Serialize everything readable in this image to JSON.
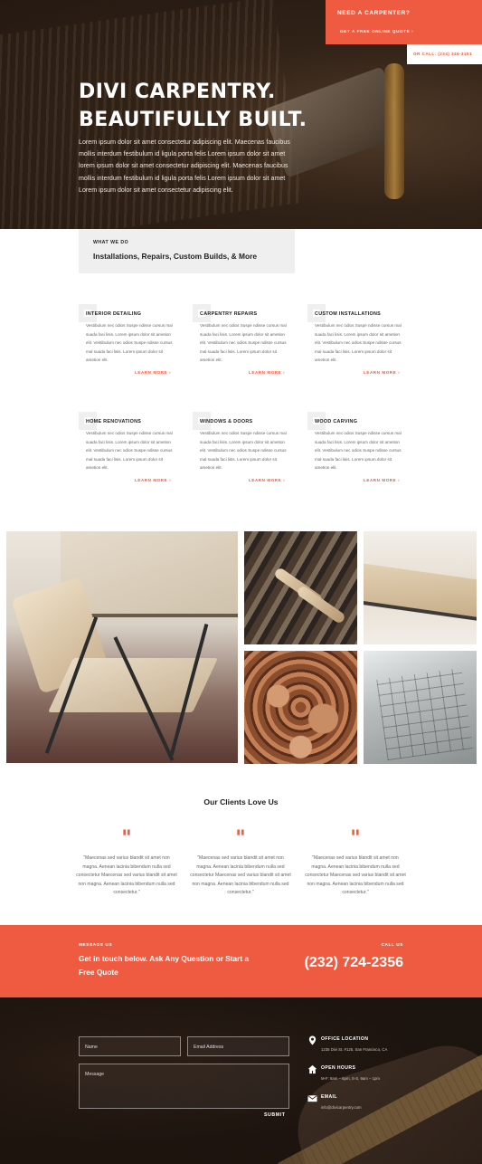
{
  "header": {
    "cta_title": "NEED A CARPENTER?",
    "cta_link": "GET A FREE ONLINE QUOTE ›",
    "phone_line": "OR CALL: (234) 346-3151"
  },
  "hero": {
    "title_line1": "DIVI CARPENTRY.",
    "title_line2": "BEAUTIFULLY BUILT.",
    "text": "Lorem ipsum dolor sit amet consectetur adipiscing elit. Maecenas faucibus mollis interdum festibulum id ligula porta felis Lorem ipsum dolor sit amet lorem ipsum dolor sit amet consectetur adipiscing elit. Maecenas faucibus mollis interdum festibulum id ligula porta felis Lorem ipsum dolor sit amet Lorem ipsum dolor sit amet consectetur adipiscing elit."
  },
  "what_we_do": {
    "kicker": "WHAT WE DO",
    "heading": "Installations, Repairs, Custom Builds, & More"
  },
  "services": [
    {
      "title": "INTERIOR DETAILING",
      "text": "Vestibulum nec odios Suspe ndisse cursus mal suada faci lisis. Lorem ipsum dolor sit ametion elit. Vestibulum nec odios Suspe ndisse cursus mal suada faci lisis. Lorem ipsum dolor sit ametion elit.",
      "link": "LEARN MORE ›"
    },
    {
      "title": "CARPENTRY REPAIRS",
      "text": "Vestibulum nec odios Suspe ndisse cursus mal suada faci lisis. Lorem ipsum dolor sit ametion elit. Vestibulum nec odios Suspe ndisse cursus mal suada faci lisis. Lorem ipsum dolor sit ametion elit.",
      "link": "LEARN MORE ›"
    },
    {
      "title": "CUSTOM INSTALLATIONS",
      "text": "Vestibulum nec odios Suspe ndisse cursus mal suada faci lisis. Lorem ipsum dolor sit ametion elit. Vestibulum nec odios Suspe ndisse cursus mal suada faci lisis. Lorem ipsum dolor sit ametion elit.",
      "link": "LEARN MORE ›"
    },
    {
      "title": "HOME RENOVATIONS",
      "text": "Vestibulum nec odios Suspe ndisse cursus mal suada faci lisis. Lorem ipsum dolor sit ametion elit. Vestibulum nec odios Suspe ndisse cursus mal suada faci lisis. Lorem ipsum dolor sit ametion elit.",
      "link": "LEARN MORE ›"
    },
    {
      "title": "WINDOWS & DOORS",
      "text": "Vestibulum nec odios Suspe ndisse cursus mal suada faci lisis. Lorem ipsum dolor sit ametion elit. Vestibulum nec odios Suspe ndisse cursus mal suada faci lisis. Lorem ipsum dolor sit ametion elit.",
      "link": "LEARN MORE ›"
    },
    {
      "title": "WOOD CARVING",
      "text": "Vestibulum nec odios Suspe ndisse cursus mal suada faci lisis. Lorem ipsum dolor sit ametion elit. Vestibulum nec odios Suspe ndisse cursus mal suada faci lisis. Lorem ipsum dolor sit ametion elit.",
      "link": "LEARN MORE ›"
    }
  ],
  "clients": {
    "title": "Our Clients Love Us",
    "quote_mark": "\"",
    "quotes": [
      "\"Maecenas sed varius blandit sit amet non magna. Aenean lacinia bibendum nulla sed consectetur Maecenas sed varius blandit sit amet non magna. Aenean lacinia bibendum nulla sed consectetur.\"",
      "\"Maecenas sed varius blandit sit amet non magna. Aenean lacinia bibendum nulla sed consectetur Maecenas sed varius blandit sit amet non magna. Aenean lacinia bibendum nulla sed consectetur.\"",
      "\"Maecenas sed varius blandit sit amet non magna. Aenean lacinia bibendum nulla sed consectetur Maecenas sed varius blandit sit amet non magna. Aenean lacinia bibendum nulla sed consectetur.\""
    ]
  },
  "contact_band": {
    "message_label": "MESSAGE US",
    "message_text": "Get in touch below. Ask Any Question or Start a Free Quote",
    "call_label": "CALL US",
    "phone": "(232) 724-2356"
  },
  "form": {
    "name_placeholder": "Name",
    "email_placeholder": "Email Address",
    "message_placeholder": "Message",
    "submit_label": "SUBMIT"
  },
  "info": {
    "office_title": "OFFICE LOCATION",
    "office_value": "1235 Divi St. #125, San Francisco, CA",
    "hours_title": "OPEN HOURS",
    "hours_value": "M-F: 8am – 6pm, S-S, 9am – 1pm",
    "email_title": "EMAIL",
    "email_value": "info@divicarpentry.com"
  },
  "icons": {
    "location": "map-pin-icon",
    "hours": "home-icon",
    "email": "envelope-icon"
  },
  "colors": {
    "accent": "#ef5b41",
    "section_gray": "#efefef"
  }
}
